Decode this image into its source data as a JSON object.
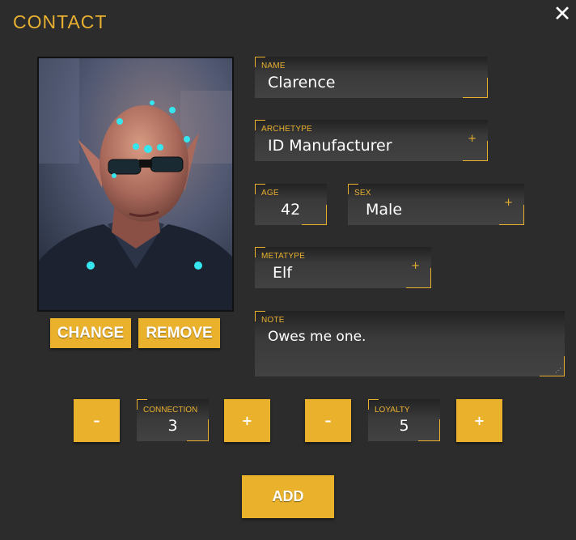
{
  "dialog": {
    "title": "CONTACT",
    "close_icon": "close-icon"
  },
  "portrait": {
    "change_label": "CHANGE",
    "remove_label": "REMOVE"
  },
  "fields": {
    "name": {
      "label": "NAME",
      "value": "Clarence"
    },
    "archetype": {
      "label": "ARCHETYPE",
      "value": "ID Manufacturer",
      "expand": "+"
    },
    "age": {
      "label": "AGE",
      "value": "42"
    },
    "sex": {
      "label": "SEX",
      "value": "Male",
      "expand": "+"
    },
    "metatype": {
      "label": "METATYPE",
      "value": "Elf",
      "expand": "+"
    },
    "note": {
      "label": "NOTE",
      "value": "Owes me one."
    }
  },
  "stats": {
    "connection": {
      "label": "CONNECTION",
      "value": "3",
      "minus": "–",
      "plus": "+"
    },
    "loyalty": {
      "label": "LOYALTY",
      "value": "5",
      "minus": "–",
      "plus": "+"
    }
  },
  "add_label": "ADD",
  "colors": {
    "accent": "#e8b030",
    "button": "#e9b12c",
    "background": "#2c2c2c"
  }
}
